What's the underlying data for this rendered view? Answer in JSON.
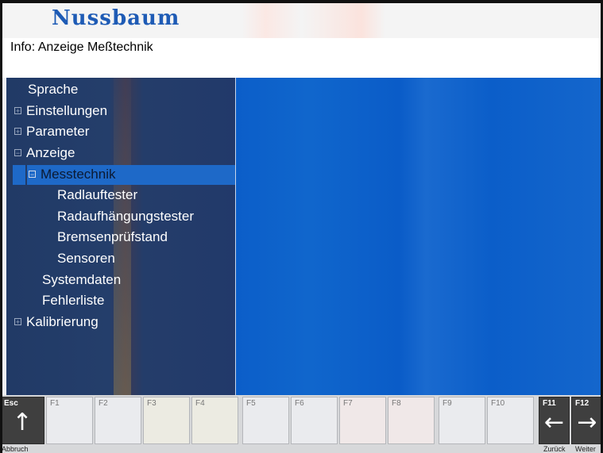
{
  "header": {
    "logo_text": "Nussbaum"
  },
  "info": {
    "text": "Info: Anzeige Meßtechnik"
  },
  "tree": {
    "items": [
      {
        "label": "Sprache",
        "expander": ""
      },
      {
        "label": "Einstellungen",
        "expander": "⊞"
      },
      {
        "label": "Parameter",
        "expander": "⊞"
      },
      {
        "label": "Anzeige",
        "expander": "⊟"
      },
      {
        "label": "Messtechnik",
        "expander": "⊟"
      },
      {
        "label": "Radlauftester",
        "expander": ""
      },
      {
        "label": "Radaufhängungstester",
        "expander": ""
      },
      {
        "label": "Bremsenprüfstand",
        "expander": ""
      },
      {
        "label": "Sensoren",
        "expander": ""
      },
      {
        "label": "Systemdaten",
        "expander": ""
      },
      {
        "label": "Fehlerliste",
        "expander": ""
      },
      {
        "label": "Kalibrierung",
        "expander": "⊞"
      }
    ]
  },
  "fkeys": {
    "esc": {
      "label": "Esc",
      "caption": "Abbruch",
      "icon": "arrow-up-icon",
      "glyph": "↑"
    },
    "f1": "F1",
    "f2": "F2",
    "f3": "F3",
    "f4": "F4",
    "f5": "F5",
    "f6": "F6",
    "f7": "F7",
    "f8": "F8",
    "f9": "F9",
    "f10": "F10",
    "f11": {
      "label": "F11",
      "caption": "Zurück",
      "icon": "arrow-left-icon",
      "glyph": "←"
    },
    "f12": {
      "label": "F12",
      "caption": "Weiter",
      "icon": "arrow-right-icon",
      "glyph": "→"
    }
  },
  "colors": {
    "accent": "#1e69c8",
    "sidebar": "#213a66",
    "main": "#0b5ec9",
    "logo": "#1e5bb5"
  }
}
